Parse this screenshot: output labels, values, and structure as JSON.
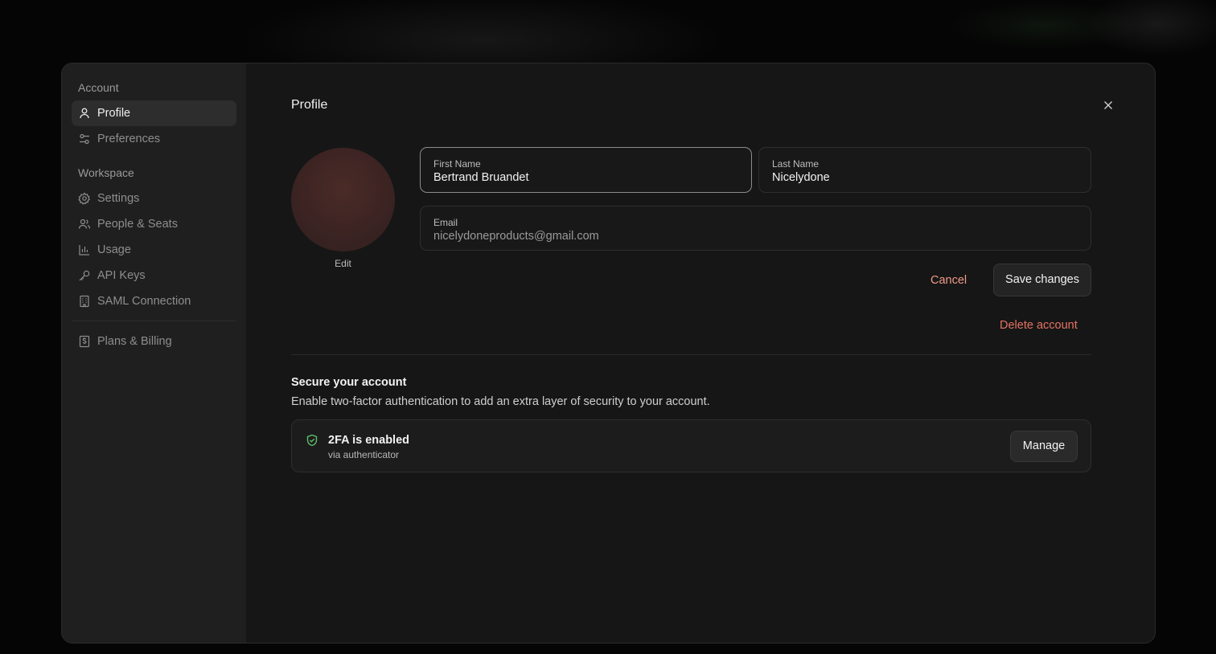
{
  "sidebar": {
    "account_label": "Account",
    "account_items": [
      {
        "label": "Profile",
        "icon": "user-icon",
        "active": true
      },
      {
        "label": "Preferences",
        "icon": "sliders-icon",
        "active": false
      }
    ],
    "workspace_label": "Workspace",
    "workspace_items": [
      {
        "label": "Settings",
        "icon": "gear-icon"
      },
      {
        "label": "People & Seats",
        "icon": "users-icon"
      },
      {
        "label": "Usage",
        "icon": "bar-chart-icon"
      },
      {
        "label": "API Keys",
        "icon": "key-icon"
      },
      {
        "label": "SAML Connection",
        "icon": "building-icon"
      }
    ],
    "billing_item": {
      "label": "Plans & Billing",
      "icon": "dollar-receipt-icon"
    }
  },
  "profile": {
    "title": "Profile",
    "avatar_edit": "Edit",
    "first_name": {
      "label": "First Name",
      "value": "Bertrand Bruandet"
    },
    "last_name": {
      "label": "Last Name",
      "value": "Nicelydone"
    },
    "email": {
      "label": "Email",
      "value": "nicelydoneproducts@gmail.com"
    },
    "cancel_label": "Cancel",
    "save_label": "Save changes",
    "delete_label": "Delete account"
  },
  "security": {
    "title": "Secure your account",
    "description": "Enable two-factor authentication to add an extra layer of security to your account.",
    "status_title": "2FA is enabled",
    "status_subtitle": "via authenticator",
    "manage_label": "Manage"
  },
  "colors": {
    "accent_cancel": "#f09a8a",
    "danger": "#e47362",
    "success_shield": "#5fbf6a"
  }
}
